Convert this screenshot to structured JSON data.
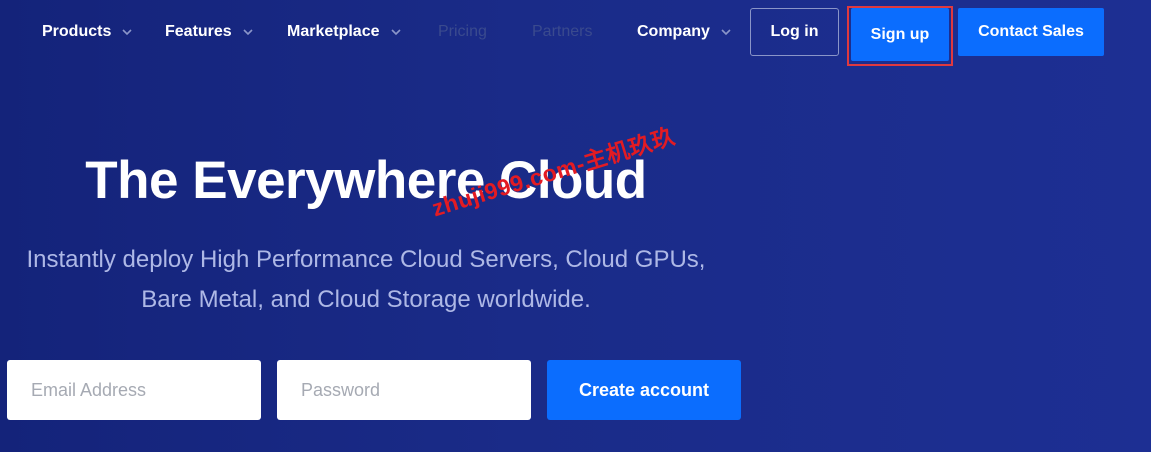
{
  "nav": {
    "items": [
      {
        "label": "Products",
        "has_dropdown": true
      },
      {
        "label": "Features",
        "has_dropdown": true
      },
      {
        "label": "Marketplace",
        "has_dropdown": true
      },
      {
        "label": "Pricing",
        "has_dropdown": false
      },
      {
        "label": "Partners",
        "has_dropdown": false
      },
      {
        "label": "Company",
        "has_dropdown": true
      }
    ],
    "login_label": "Log in",
    "signup_label": "Sign up",
    "contact_label": "Contact Sales"
  },
  "hero": {
    "title": "The Everywhere Cloud",
    "subtitle": "Instantly deploy High Performance Cloud Servers, Cloud GPUs, Bare Metal, and Cloud Storage worldwide."
  },
  "form": {
    "email_placeholder": "Email Address",
    "password_placeholder": "Password",
    "submit_label": "Create account"
  },
  "watermark": "zhuji999.com-主机玖玖",
  "colors": {
    "background": "#1a2b88",
    "accent": "#0b6dfe",
    "highlight": "#e0393f",
    "subtitle": "#aeb8e6"
  }
}
